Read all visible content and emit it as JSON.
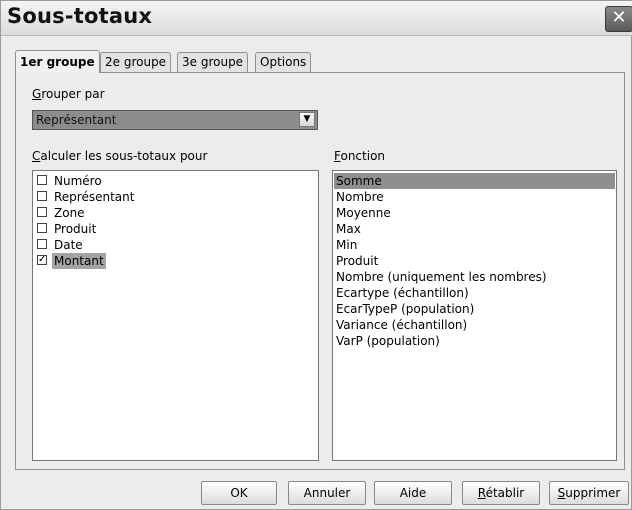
{
  "dialog": {
    "title": "Sous-totaux",
    "close_icon": "close-icon"
  },
  "tabs": [
    {
      "label": "1er groupe",
      "active": true
    },
    {
      "label": "2e groupe",
      "active": false
    },
    {
      "label": "3e groupe",
      "active": false
    },
    {
      "label": "Options",
      "active": false
    }
  ],
  "group_by": {
    "label_mnemonic": "G",
    "label_rest": "rouper par",
    "selected": "Représentant"
  },
  "subtotals_for": {
    "label_mnemonic": "C",
    "label_rest": "alculer les sous-totaux pour",
    "items": [
      {
        "label": "Numéro",
        "checked": false
      },
      {
        "label": "Représentant",
        "checked": false
      },
      {
        "label": "Zone",
        "checked": false
      },
      {
        "label": "Produit",
        "checked": false
      },
      {
        "label": "Date",
        "checked": false
      },
      {
        "label": "Montant",
        "checked": true
      }
    ]
  },
  "function": {
    "label_mnemonic": "F",
    "label_rest": "onction",
    "selected": "Somme",
    "items": [
      "Somme",
      "Nombre",
      "Moyenne",
      "Max",
      "Min",
      "Produit",
      "Nombre (uniquement les nombres)",
      "Ecartype (échantillon)",
      "EcarTypeP (population)",
      "Variance (échantillon)",
      "VarP (population)"
    ]
  },
  "buttons": {
    "ok": "OK",
    "cancel": "Annuler",
    "help": "Aide",
    "reset_mnemonic": "R",
    "reset_rest": "établir",
    "delete_mnemonic": "S",
    "delete_rest": "upprimer"
  }
}
